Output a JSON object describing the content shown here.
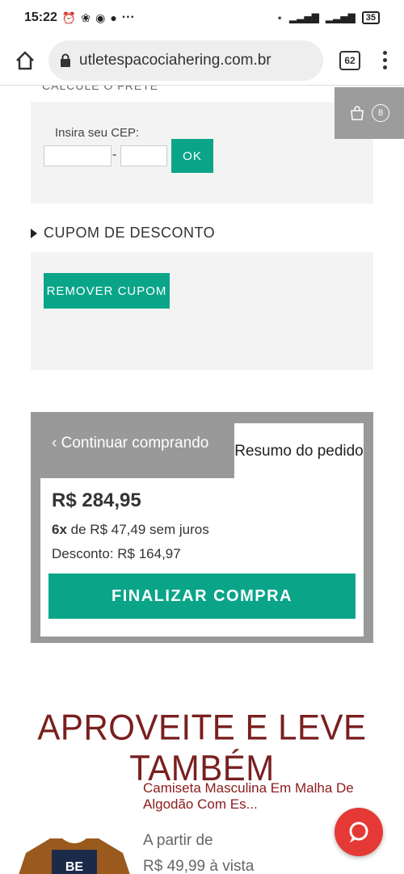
{
  "status_bar": {
    "time": "15:22",
    "icons": [
      "alarm-icon",
      "flower-icon",
      "camera-icon",
      "notification-icon"
    ],
    "more": "···",
    "battery": "35"
  },
  "browser": {
    "url": "utletespacociahering.com.br",
    "tab_count": "62"
  },
  "cart": {
    "count": "8"
  },
  "frete": {
    "heading_cut": "CALCULE O FRETE",
    "cep_label": "Insira seu CEP:",
    "dash": "-",
    "ok_label": "OK"
  },
  "cupom": {
    "title": "CUPOM DE DESCONTO",
    "remove_label": "REMOVER CUPOM"
  },
  "resumo": {
    "continue_label": "Continuar comprando",
    "tab_label": "Resumo do pedido",
    "total": "R$ 284,95",
    "installments_count": "6x",
    "installments_text": "de R$ 47,49 sem juros",
    "discount": "Desconto: R$ 164,97",
    "checkout_label": "FINALIZAR COMPRA"
  },
  "recommend": {
    "title": "APROVEITE E LEVE TAMBÉM",
    "product_name": "Camiseta Masculina Em Malha De Algodão Com Es...",
    "from_label": "A partir de",
    "price_vista": "R$ 49,99 à vista",
    "shirt_print": "BE"
  },
  "colors": {
    "accent": "#0aa589",
    "title_red": "#7a1f1f",
    "chat": "#e53935"
  }
}
